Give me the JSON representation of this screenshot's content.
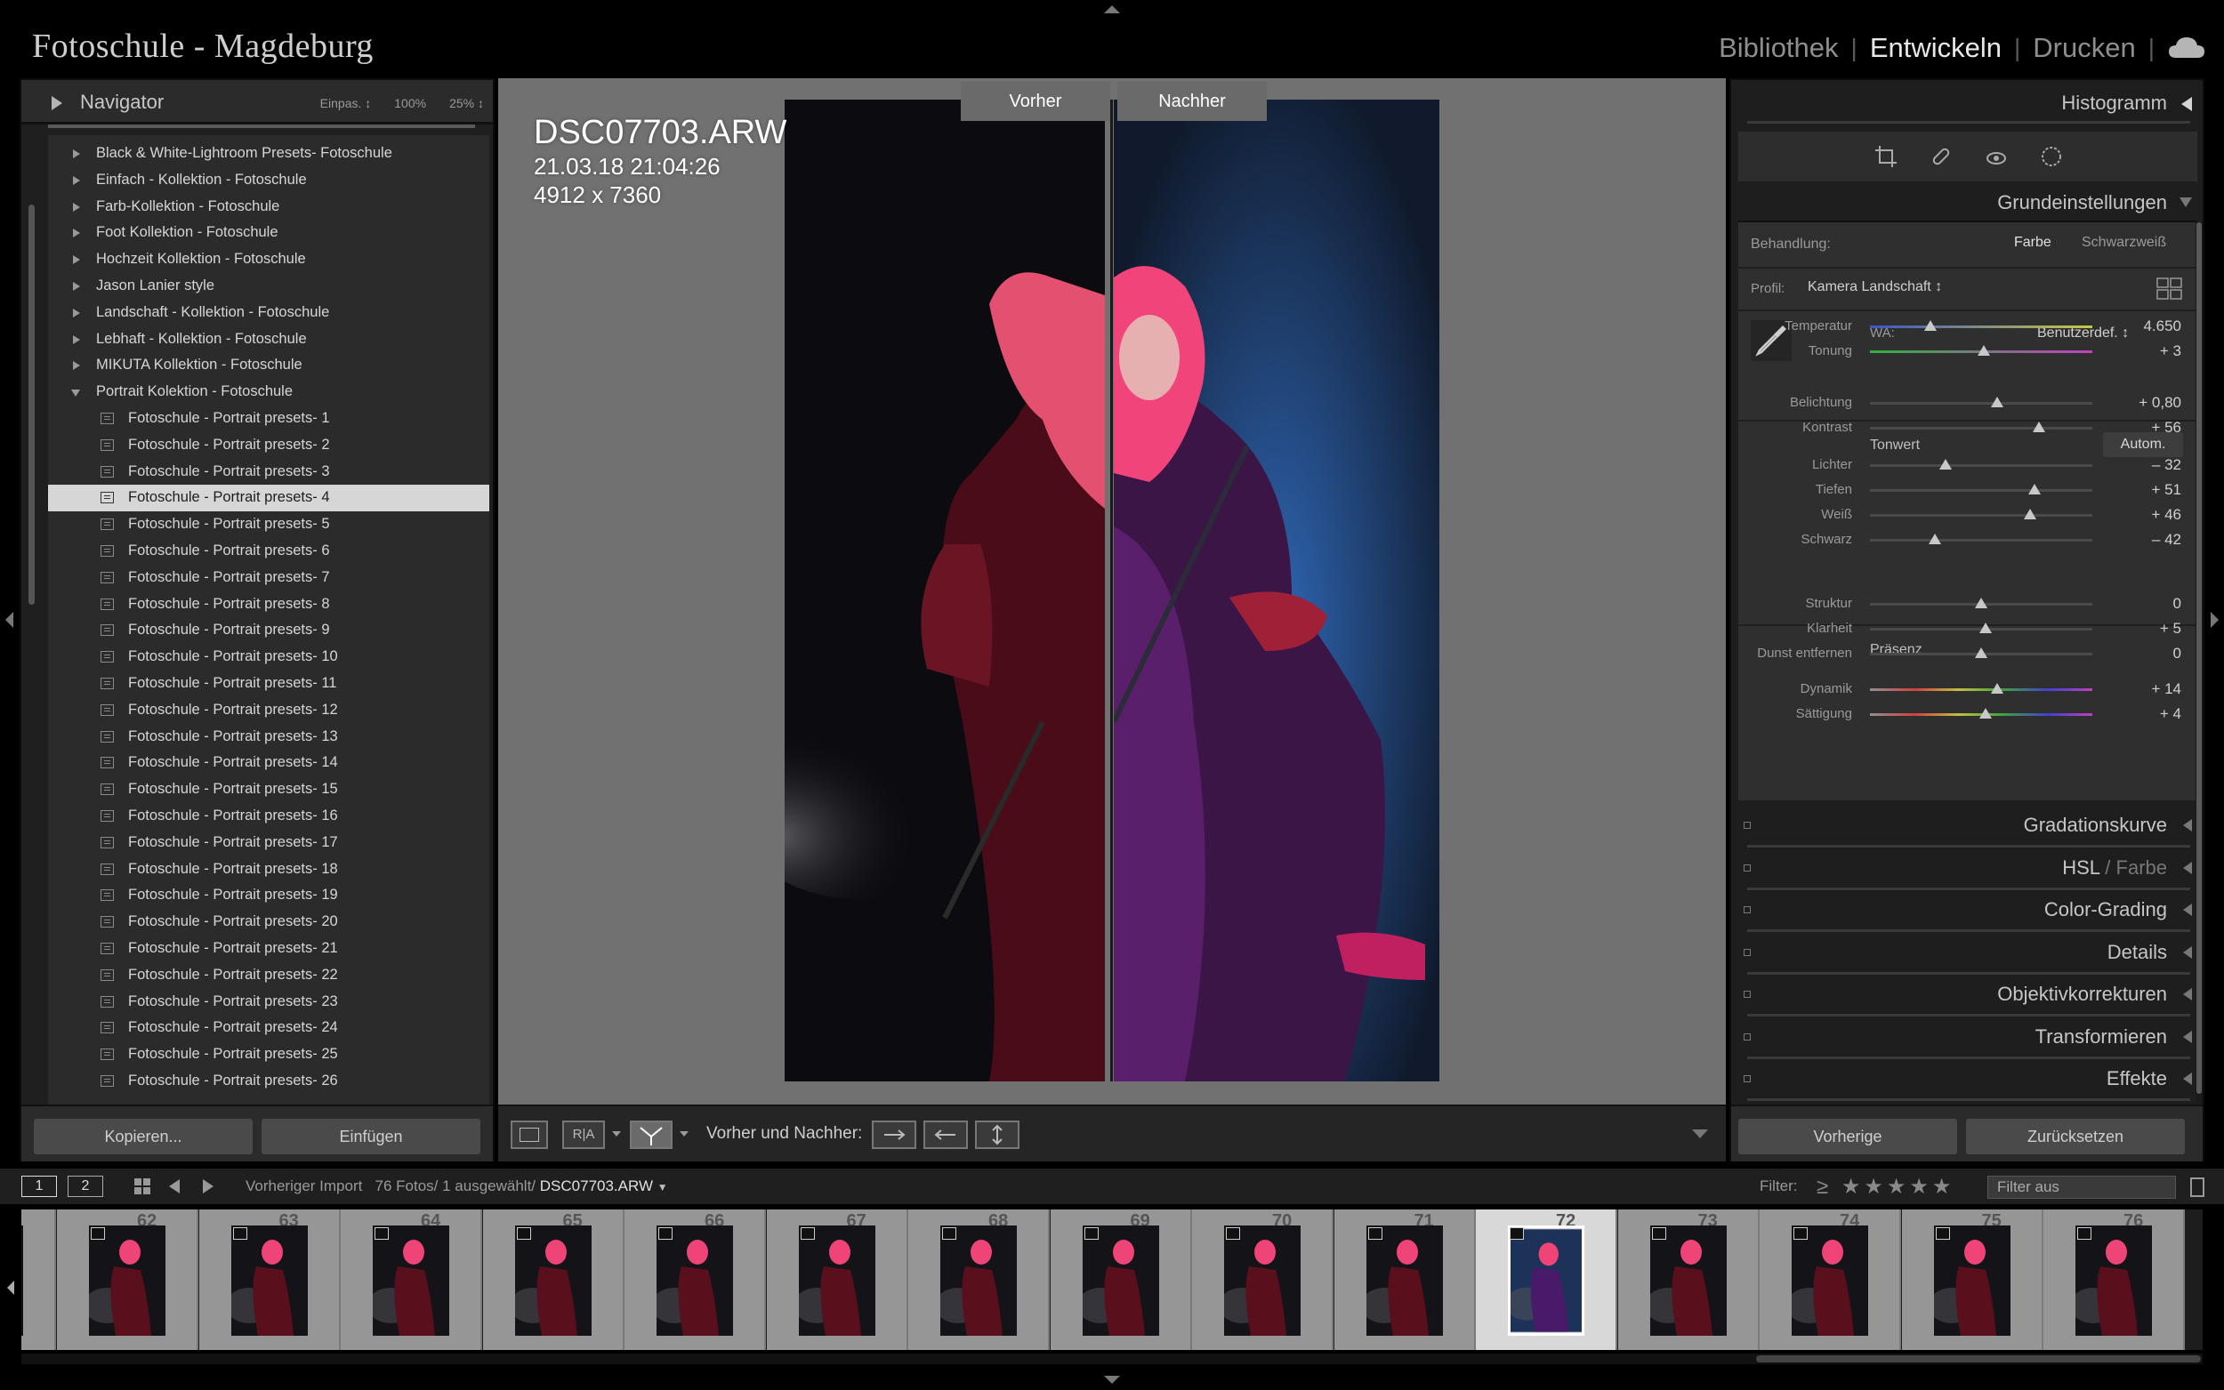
{
  "app": {
    "identity_plate": "Fotoschule - Magdeburg",
    "modules": [
      "Bibliothek",
      "Entwickeln",
      "Drucken"
    ],
    "active_module": "Entwickeln"
  },
  "navigator": {
    "title": "Navigator",
    "zoom_options": [
      "Einpas. ↕",
      "100%",
      "25% ↕"
    ]
  },
  "presets": {
    "groups": [
      "Black & White-Lightroom Presets- Fotoschule",
      "Einfach - Kollektion - Fotoschule",
      "Farb-Kollektion - Fotoschule",
      "Foot Kollektion - Fotoschule",
      "Hochzeit Kollektion - Fotoschule",
      "Jason Lanier style",
      "Landschaft - Kollektion - Fotoschule",
      "Lebhaft - Kollektion - Fotoschule",
      "MIKUTA Kollektion - Fotoschule",
      "Portrait Kolektion - Fotoschule"
    ],
    "open_group": "Portrait Kolektion - Fotoschule",
    "children": [
      "Fotoschule - Portrait presets- 1",
      "Fotoschule - Portrait presets- 2",
      "Fotoschule - Portrait presets- 3",
      "Fotoschule - Portrait presets- 4",
      "Fotoschule - Portrait presets- 5",
      "Fotoschule - Portrait presets- 6",
      "Fotoschule - Portrait presets- 7",
      "Fotoschule - Portrait presets- 8",
      "Fotoschule - Portrait presets- 9",
      "Fotoschule - Portrait presets- 10",
      "Fotoschule - Portrait presets- 11",
      "Fotoschule - Portrait presets- 12",
      "Fotoschule - Portrait presets- 13",
      "Fotoschule - Portrait presets- 14",
      "Fotoschule - Portrait presets- 15",
      "Fotoschule - Portrait presets- 16",
      "Fotoschule - Portrait presets- 17",
      "Fotoschule - Portrait presets- 18",
      "Fotoschule - Portrait presets- 19",
      "Fotoschule - Portrait presets- 20",
      "Fotoschule - Portrait presets- 21",
      "Fotoschule - Portrait presets- 22",
      "Fotoschule - Portrait presets- 23",
      "Fotoschule - Portrait presets- 24",
      "Fotoschule - Portrait presets- 25",
      "Fotoschule - Portrait presets- 26"
    ],
    "selected_child": "Fotoschule - Portrait presets- 4"
  },
  "left_buttons": {
    "copy": "Kopieren...",
    "paste": "Einfügen"
  },
  "photo": {
    "filename": "DSC07703.ARW",
    "datetime": "21.03.18 21:04:26",
    "dimensions": "4912 x 7360",
    "before_label": "Vorher",
    "after_label": "Nachher"
  },
  "toolbar": {
    "view_mode_label": "Vorher und Nachher:"
  },
  "right_panel": {
    "histogram_title": "Histogramm",
    "basic_title": "Grundeinstellungen",
    "treatment_label": "Behandlung:",
    "treatment_options": [
      "Farbe",
      "Schwarzweiß"
    ],
    "profile_label": "Profil:",
    "profile_value": "Kamera Landschaft ↕",
    "wb_label": "WA:",
    "wb_value": "Benutzerdef. ↕",
    "tone_title": "Tonwert",
    "auto_button": "Autom.",
    "presence_title": "Präsenz",
    "sliders": [
      {
        "label": "Temperatur",
        "value": "4.650",
        "position": 0.27,
        "group": "wb"
      },
      {
        "label": "Tonung",
        "value": "+ 3",
        "position": 0.51,
        "group": "wb"
      },
      {
        "label": "Belichtung",
        "value": "+ 0,80",
        "position": 0.57,
        "group": "tone"
      },
      {
        "label": "Kontrast",
        "value": "+ 56",
        "position": 0.76,
        "group": "tone"
      },
      {
        "label": "Lichter",
        "value": "– 32",
        "position": 0.34,
        "group": "tone2"
      },
      {
        "label": "Tiefen",
        "value": "+ 51",
        "position": 0.74,
        "group": "tone2"
      },
      {
        "label": "Weiß",
        "value": "+ 46",
        "position": 0.72,
        "group": "tone2"
      },
      {
        "label": "Schwarz",
        "value": "– 42",
        "position": 0.29,
        "group": "tone2"
      },
      {
        "label": "Struktur",
        "value": "0",
        "position": 0.5,
        "group": "presence"
      },
      {
        "label": "Klarheit",
        "value": "+ 5",
        "position": 0.52,
        "group": "presence"
      },
      {
        "label": "Dunst entfernen",
        "value": "0",
        "position": 0.5,
        "group": "presence"
      },
      {
        "label": "Dynamik",
        "value": "+ 14",
        "position": 0.57,
        "group": "presence2"
      },
      {
        "label": "Sättigung",
        "value": "+ 4",
        "position": 0.52,
        "group": "presence2"
      }
    ],
    "sections": [
      "Gradationskurve",
      "HSL",
      "Color-Grading",
      "Details",
      "Objektivkorrekturen",
      "Transformieren",
      "Effekte"
    ],
    "hsl_suffix": "Farbe",
    "buttons": {
      "previous": "Vorherige",
      "reset": "Zurücksetzen"
    }
  },
  "filmbar": {
    "page1": "1",
    "page2": "2",
    "source": "Vorheriger Import",
    "count": "76 Fotos/",
    "selected": "1 ausgewählt/",
    "file": "DSC07703.ARW",
    "filter_label": "Filter:",
    "stars": "≥ ★★★★★",
    "filter_value": "Filter aus"
  },
  "filmstrip": {
    "numbers": [
      "",
      "62",
      "63",
      "64",
      "65",
      "66",
      "67",
      "68",
      "69",
      "70",
      "71",
      "72",
      "73",
      "74",
      "75",
      "76"
    ],
    "selected_number": "72"
  },
  "colors": {
    "accent_selected": "#d6d6d6",
    "hair": "#f0447a",
    "after_bg": "#1b2f4c"
  }
}
